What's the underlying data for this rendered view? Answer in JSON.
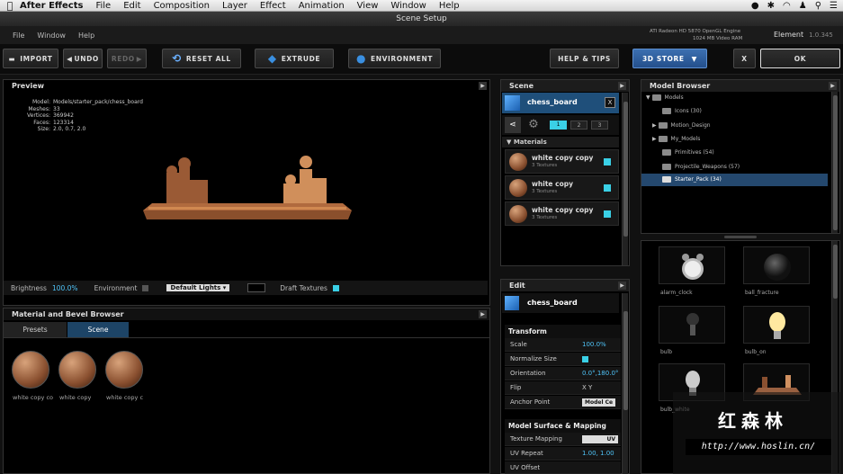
{
  "mac_menubar": {
    "apple": "",
    "app": "After Effects",
    "items": [
      "File",
      "Edit",
      "Composition",
      "Layer",
      "Effect",
      "Animation",
      "View",
      "Window",
      "Help"
    ]
  },
  "window_title": "Scene Setup",
  "app_menu": [
    "File",
    "Window",
    "Help"
  ],
  "gpu_info": {
    "line1": "ATI Radeon HD 5870 OpenGL Engine",
    "line2": "1024 MB Video RAM"
  },
  "plugin": {
    "name": "Element",
    "version": "1.0.345"
  },
  "toolbar": {
    "import": "IMPORT",
    "undo": "UNDO",
    "redo": "REDO",
    "reset_all": "RESET ALL",
    "extrude": "EXTRUDE",
    "environment": "ENVIRONMENT",
    "help_tips": "HELP & TIPS",
    "store": "3D STORE",
    "close": "X",
    "ok": "OK"
  },
  "preview": {
    "title": "Preview",
    "info": [
      {
        "k": "Model:",
        "v": "Models/starter_pack/chess_board"
      },
      {
        "k": "Meshes:",
        "v": "33"
      },
      {
        "k": "Vertices:",
        "v": "369942"
      },
      {
        "k": "Faces:",
        "v": "123314"
      },
      {
        "k": "Size:",
        "v": "2.0, 0.7, 2.0"
      }
    ],
    "brightness_label": "Brightness",
    "brightness_value": "100.0%",
    "environment_label": "Environment",
    "lights_value": "Default Lights",
    "draft_label": "Draft Textures"
  },
  "material_browser": {
    "title": "Material and Bevel Browser",
    "tabs": [
      "Presets",
      "Scene"
    ],
    "items": [
      "white copy co",
      "white copy",
      "white copy c"
    ]
  },
  "scene": {
    "title": "Scene",
    "object": "chess_board",
    "close": "X",
    "groups": [
      "1",
      "2",
      "3"
    ],
    "materials_label": "Materials",
    "materials": [
      {
        "name": "white copy copy",
        "sub": "3 Textures"
      },
      {
        "name": "white copy",
        "sub": "3 Textures"
      },
      {
        "name": "white copy copy",
        "sub": "3 Textures"
      }
    ]
  },
  "edit": {
    "title": "Edit",
    "object": "chess_board",
    "transform_label": "Transform",
    "rows": [
      {
        "k": "Scale",
        "v": "100.0%"
      },
      {
        "k": "Normalize Size",
        "v": ""
      },
      {
        "k": "Orientation",
        "v": "0.0°,180.0°"
      },
      {
        "k": "Flip",
        "v": "X    Y"
      },
      {
        "k": "Anchor Point",
        "v": "Model Ce"
      }
    ],
    "surface_label": "Model Surface & Mapping",
    "surface_rows": [
      {
        "k": "Texture Mapping",
        "v": "UV"
      },
      {
        "k": "UV Repeat",
        "v": "1.00, 1.00"
      },
      {
        "k": "UV Offset",
        "v": ""
      }
    ]
  },
  "model_browser": {
    "title": "Model Browser",
    "root": "Models",
    "folders": [
      "Icons (30)",
      "Motion_Design",
      "My_Models",
      "Primitives (54)",
      "Projectile_Weapons (57)",
      "Starter_Pack (34)"
    ],
    "thumbs": [
      "alarm_clock",
      "ball_fracture",
      "bulb",
      "bulb_on",
      "bulb_white",
      ""
    ]
  },
  "watermark": {
    "name": "红森林",
    "url": "http://www.hoslin.cn/"
  }
}
